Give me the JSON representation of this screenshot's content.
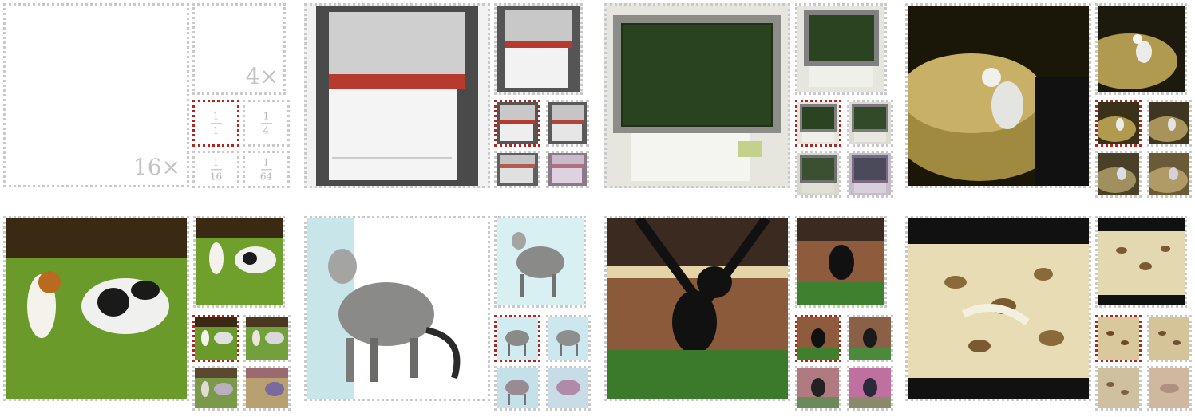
{
  "legend": {
    "scale_big": "16×",
    "scale_medium": "4×",
    "cells": [
      {
        "num": "1",
        "den": "1"
      },
      {
        "num": "1",
        "den": "4"
      },
      {
        "num": "1",
        "den": "16"
      },
      {
        "num": "1",
        "den": "64"
      }
    ]
  },
  "examples": [
    {
      "subject": "dishwasher"
    },
    {
      "subject": "laptop-computer"
    },
    {
      "subject": "bird-in-nest"
    },
    {
      "subject": "dogs-on-grass"
    },
    {
      "subject": "spotted-cat"
    },
    {
      "subject": "black-monkey"
    },
    {
      "subject": "leopard-print-poster"
    }
  ],
  "colors": {
    "dotted_border": "#c9c9c9",
    "highlight_border": "#b3261e"
  }
}
